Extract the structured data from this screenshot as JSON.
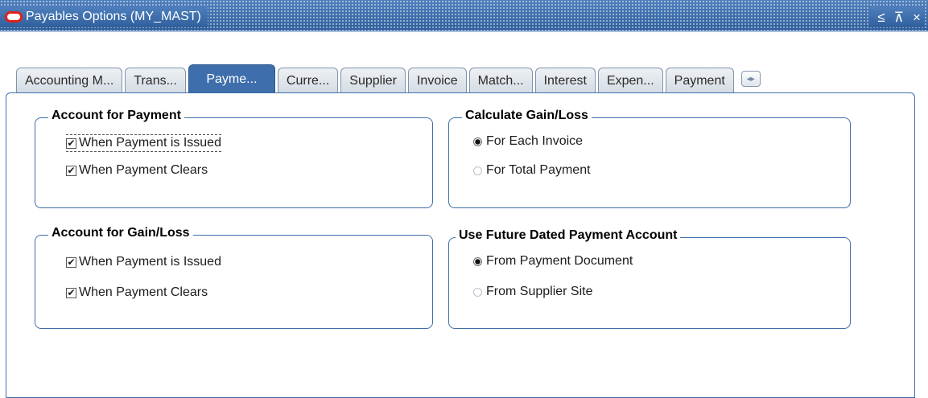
{
  "window": {
    "title": "Payables Options (MY_MAST)",
    "controls": {
      "minimize": "≤",
      "maximize": "⊼",
      "close": "×"
    }
  },
  "tabs": [
    {
      "label": "Accounting M...",
      "active": false
    },
    {
      "label": "Trans...",
      "active": false
    },
    {
      "label": "Payme...",
      "active": true
    },
    {
      "label": "Curre...",
      "active": false
    },
    {
      "label": "Supplier",
      "active": false
    },
    {
      "label": "Invoice",
      "active": false
    },
    {
      "label": "Match...",
      "active": false
    },
    {
      "label": "Interest",
      "active": false
    },
    {
      "label": "Expen...",
      "active": false
    },
    {
      "label": "Payment",
      "active": false
    }
  ],
  "tab_scroll_icon": "◂▸",
  "groups": {
    "account_for_payment": {
      "title": "Account for Payment",
      "options": [
        {
          "label": "When Payment is Issued",
          "checked": true,
          "mark": "✔"
        },
        {
          "label": "When Payment Clears",
          "checked": true,
          "mark": "✔"
        }
      ]
    },
    "calculate_gain_loss": {
      "title": "Calculate Gain/Loss",
      "options": [
        {
          "label": "For Each Invoice",
          "selected": true
        },
        {
          "label": "For Total Payment",
          "selected": false
        }
      ]
    },
    "account_for_gain_loss": {
      "title": "Account for Gain/Loss",
      "options": [
        {
          "label": "When Payment is Issued",
          "checked": true,
          "mark": "✔"
        },
        {
          "label": "When Payment Clears",
          "checked": true,
          "mark": "✔"
        }
      ]
    },
    "future_dated_account": {
      "title": "Use Future Dated Payment Account",
      "options": [
        {
          "label": "From Payment Document",
          "selected": true
        },
        {
          "label": "From Supplier Site",
          "selected": false
        }
      ]
    }
  },
  "colors": {
    "accent": "#3e6eab",
    "close_icon_brand": "#e0201c"
  }
}
